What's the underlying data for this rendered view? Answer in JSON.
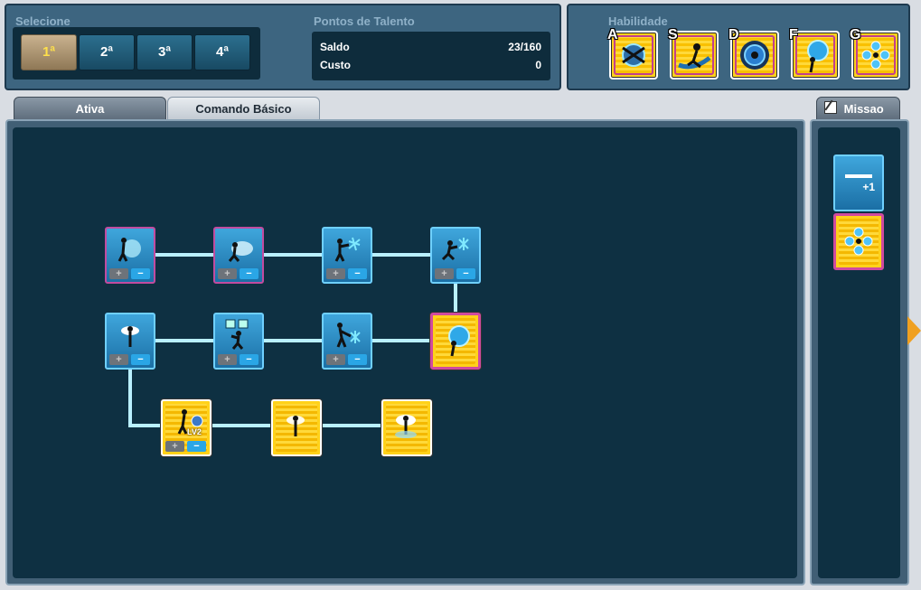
{
  "select": {
    "label": "Selecione",
    "buttons": [
      "1ª",
      "2ª",
      "3ª",
      "4ª"
    ],
    "active_index": 0
  },
  "talent_points": {
    "label": "Pontos de Talento",
    "rows": [
      {
        "label": "Saldo",
        "value": "23/160"
      },
      {
        "label": "Custo",
        "value": "0"
      }
    ]
  },
  "skills_bar": {
    "label": "Habilidade",
    "slots": [
      {
        "key": "A",
        "icon": "wind-burst-icon"
      },
      {
        "key": "S",
        "icon": "dash-slash-icon"
      },
      {
        "key": "D",
        "icon": "blue-sphere-icon"
      },
      {
        "key": "F",
        "icon": "chain-orb-icon"
      },
      {
        "key": "G",
        "icon": "snowflake-aura-icon"
      }
    ]
  },
  "tabs": [
    {
      "label": "Ativa",
      "active": false
    },
    {
      "label": "Comando Básico",
      "active": true
    }
  ],
  "mission_tab": {
    "label": "Missao",
    "icon": "note-pencil-icon"
  },
  "tree": {
    "controls": {
      "plus": "+",
      "minus": "−"
    },
    "nodes": [
      {
        "id": "n1",
        "style": "blue-pink",
        "icon": "ice-shield-figure-icon",
        "controls": true
      },
      {
        "id": "n2",
        "style": "blue-pink",
        "icon": "splash-strike-figure-icon",
        "controls": true
      },
      {
        "id": "n3",
        "style": "blue",
        "icon": "ice-shot-figure-icon",
        "controls": true
      },
      {
        "id": "n4",
        "style": "blue",
        "icon": "frost-run-figure-icon",
        "controls": true
      },
      {
        "id": "n5",
        "style": "blue",
        "icon": "aura-figure-icon",
        "controls": true
      },
      {
        "id": "n6",
        "style": "blue",
        "icon": "screens-figure-icon",
        "controls": true
      },
      {
        "id": "n7",
        "style": "blue",
        "icon": "ice-lunge-figure-icon",
        "controls": true
      },
      {
        "id": "n8",
        "style": "gold-pink",
        "icon": "chain-orb-figure-icon",
        "controls": false
      },
      {
        "id": "n9",
        "style": "gold",
        "icon": "charged-figure-icon",
        "controls": true,
        "badge": "LV2"
      },
      {
        "id": "n10",
        "style": "gold",
        "icon": "lightning-figure-icon",
        "controls": false
      },
      {
        "id": "n11",
        "style": "gold",
        "icon": "whirl-figure-icon",
        "controls": false
      }
    ]
  },
  "side_items": [
    {
      "icon": "plus-one-bonus-icon",
      "text": "+1"
    },
    {
      "icon": "snowflake-aura-icon"
    }
  ]
}
